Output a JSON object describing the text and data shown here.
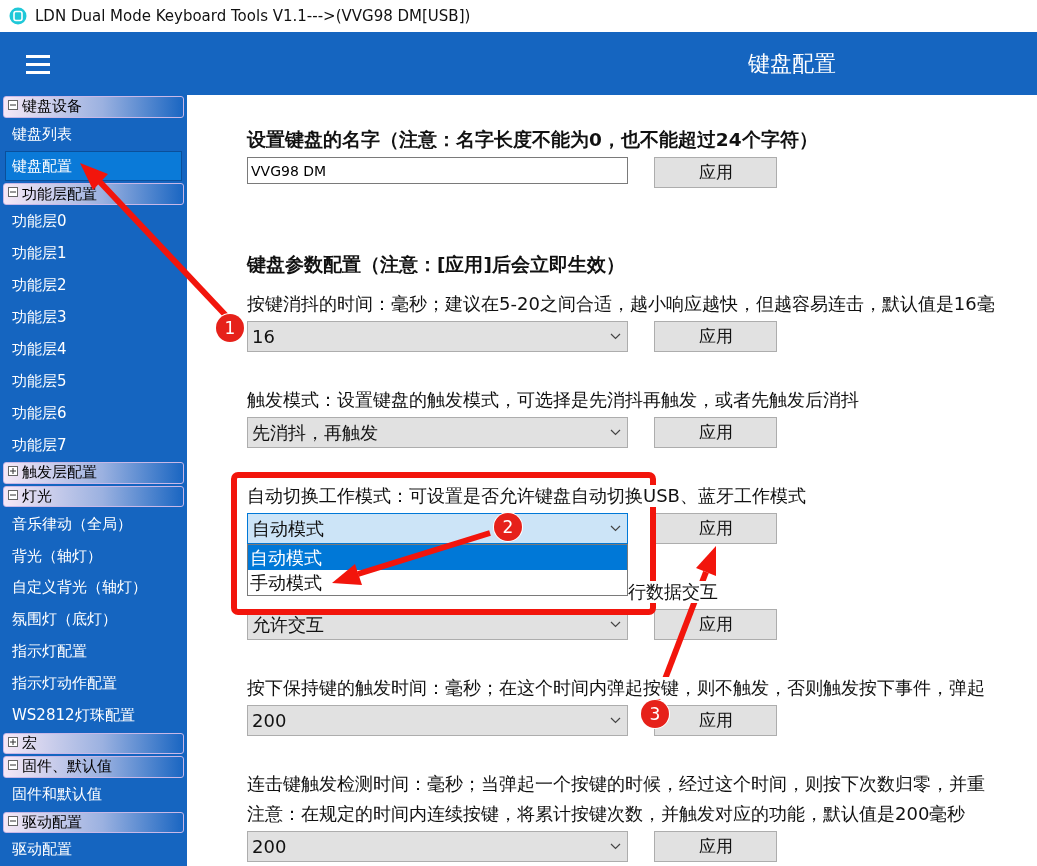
{
  "window": {
    "title": "LDN Dual Mode Keyboard Tools V1.1--->(VVG98 DM[USB])"
  },
  "header": {
    "title": "键盘配置"
  },
  "sidebar": {
    "groups": [
      {
        "label": "键盘设备",
        "expanded": true,
        "items": [
          {
            "label": "键盘列表",
            "selected": false
          },
          {
            "label": "键盘配置",
            "selected": true
          }
        ]
      },
      {
        "label": "功能层配置",
        "expanded": true,
        "items": [
          {
            "label": "功能层0",
            "selected": false
          },
          {
            "label": "功能层1",
            "selected": false
          },
          {
            "label": "功能层2",
            "selected": false
          },
          {
            "label": "功能层3",
            "selected": false
          },
          {
            "label": "功能层4",
            "selected": false
          },
          {
            "label": "功能层5",
            "selected": false
          },
          {
            "label": "功能层6",
            "selected": false
          },
          {
            "label": "功能层7",
            "selected": false
          }
        ]
      },
      {
        "label": "触发层配置",
        "expanded": false
      },
      {
        "label": "灯光",
        "expanded": true,
        "items": [
          {
            "label": "音乐律动（全局）",
            "selected": false
          },
          {
            "label": "背光（轴灯）",
            "selected": false
          },
          {
            "label": "自定义背光（轴灯）",
            "selected": false
          },
          {
            "label": "氛围灯（底灯）",
            "selected": false
          },
          {
            "label": "指示灯配置",
            "selected": false
          },
          {
            "label": "指示灯动作配置",
            "selected": false
          },
          {
            "label": "WS2812灯珠配置",
            "selected": false
          }
        ]
      },
      {
        "label": "宏",
        "expanded": false
      },
      {
        "label": "固件、默认值",
        "expanded": true,
        "items": [
          {
            "label": "固件和默认值",
            "selected": false
          }
        ]
      },
      {
        "label": "驱动配置",
        "expanded": true,
        "items": [
          {
            "label": "驱动配置",
            "selected": false
          }
        ]
      }
    ]
  },
  "name_section": {
    "title": "设置键盘的名字（注意：名字长度不能为0，也不能超过24个字符）",
    "value": "VVG98 DM",
    "button": "应用"
  },
  "param_section": {
    "title": "键盘参数配置（注意：[应用]后会立即生效）",
    "rows": [
      {
        "lines": [
          "按键消抖的时间：毫秒；建议在5-20之间合适，越小响应越快，但越容易连击，默认值是16毫"
        ],
        "value": "16",
        "button": "应用",
        "focused": false,
        "open": false
      },
      {
        "lines": [
          "触发模式：设置键盘的触发模式，可选择是先消抖再触发，或者先触发后消抖"
        ],
        "value": "先消抖，再触发",
        "button": "应用",
        "focused": false,
        "open": false
      },
      {
        "lines": [
          "自动切换工作模式：可设置是否允许键盘自动切换USB、蓝牙工作模式"
        ],
        "value": "自动模式",
        "button": "应用",
        "focused": true,
        "open": true,
        "options": [
          {
            "label": "自动模式",
            "selected": true
          },
          {
            "label": "手动模式",
            "selected": false
          }
        ]
      },
      {
        "lines": [
          "行数据交互"
        ],
        "value": "允许交互",
        "button": "应用",
        "focused": false,
        "open": false
      },
      {
        "lines": [
          "按下保持键的触发时间：毫秒；在这个时间内弹起按键，则不触发，否则触发按下事件，弹起"
        ],
        "value": "200",
        "button": "应用",
        "focused": false,
        "open": false
      },
      {
        "lines": [
          "连击键触发检测时间：毫秒；当弹起一个按键的时候，经过这个时间，则按下次数归零，并重",
          "注意：在规定的时间内连续按键，将累计按键次数，并触发对应的功能，默认值是200毫秒"
        ],
        "value": "200",
        "button": "应用",
        "focused": false,
        "open": false
      }
    ]
  },
  "annotations": {
    "badges": [
      "1",
      "2",
      "3"
    ]
  }
}
